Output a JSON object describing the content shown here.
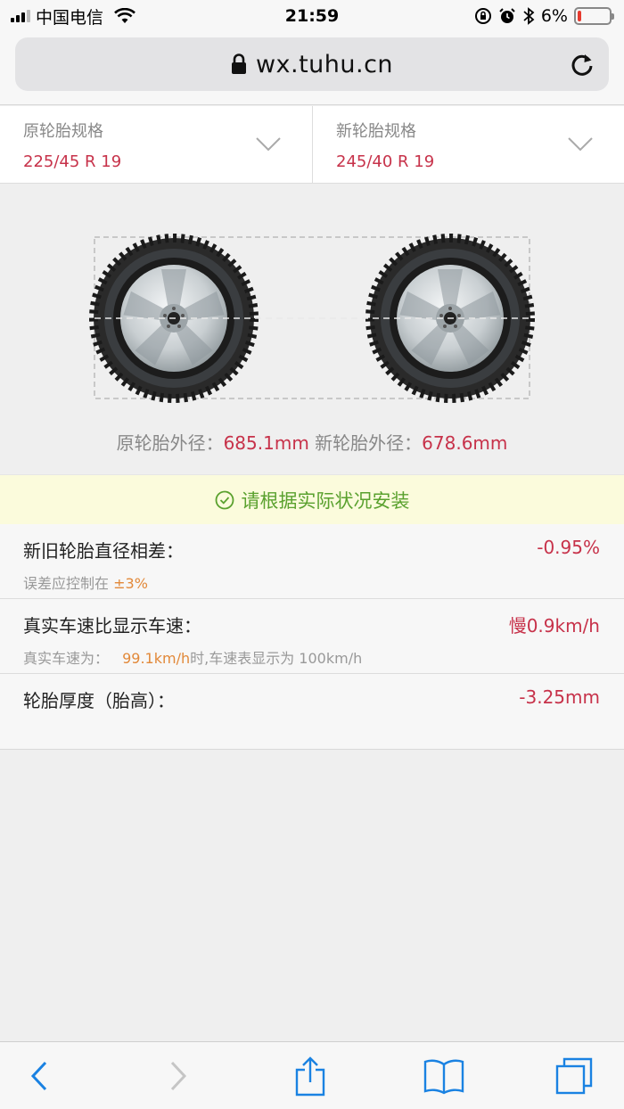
{
  "status_bar": {
    "carrier": "中国电信",
    "time": "21:59",
    "battery": "6%",
    "battery_level": 0.06
  },
  "browser": {
    "url": "wx.tuhu.cn"
  },
  "specs": {
    "original_label": "原轮胎规格",
    "original_value": "225/45 R 19",
    "new_label": "新轮胎规格",
    "new_value": "245/40 R 19"
  },
  "diameters": {
    "original_label": "原轮胎外径：",
    "original_value": "685.1mm",
    "new_label": "新轮胎外径：",
    "new_value": "678.6mm"
  },
  "notice": {
    "text": "请根据实际状况安装"
  },
  "results": {
    "diameter_diff": {
      "title": "新旧轮胎直径相差：",
      "value": "-0.95%",
      "sub_prefix": "误差应控制在",
      "sub_highlight": "±3%"
    },
    "speed": {
      "title": "真实车速比显示车速：",
      "value": "慢0.9km/h",
      "sub_prefix": "真实车速为：",
      "sub_highlight": "99.1km/h",
      "sub_suffix": "时,车速表显示为 100km/h"
    },
    "thickness": {
      "title": "轮胎厚度（胎高）：",
      "value": "-3.25mm"
    }
  },
  "toolbar": {
    "back_icon": "chevron-left-icon",
    "forward_icon": "chevron-right-icon",
    "share_icon": "share-icon",
    "bookmarks_icon": "book-icon",
    "tabs_icon": "tabs-icon"
  },
  "colors": {
    "accent_red": "#c7324a",
    "accent_orange": "#e2893a",
    "notice_green": "#5aa12e",
    "ios_blue": "#1a82e2"
  }
}
